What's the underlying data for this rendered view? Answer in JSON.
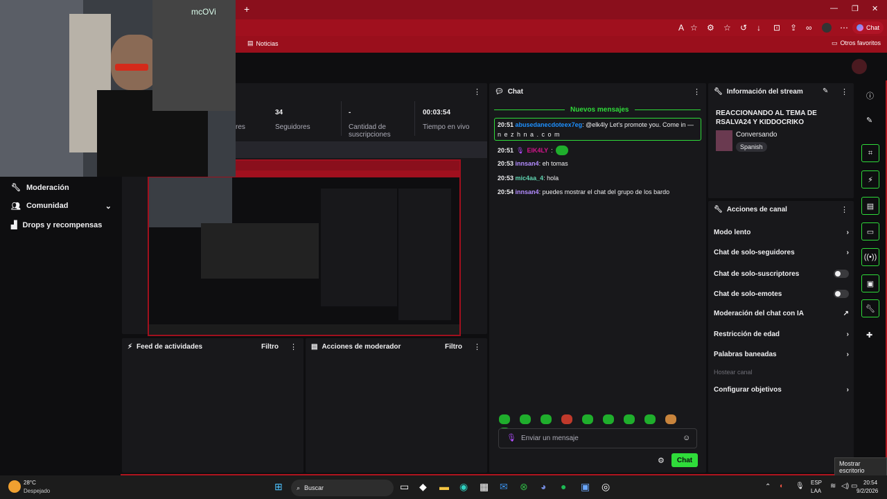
{
  "browser": {
    "bookmarks": {
      "noticias": "Noticias",
      "other": "Otros favoritos"
    },
    "chat_button": "Chat"
  },
  "webcam": {
    "watermark": "mcOVi"
  },
  "stats": {
    "seguidores_value": "34",
    "seguidores_label": "Seguidores",
    "subs_value": "-",
    "subs_label": "Cantidad de suscripciones",
    "live_value": "00:03:54",
    "live_label": "Tiempo en vivo",
    "partial_label": "res"
  },
  "sidenav": {
    "items": [
      {
        "label": "Moderación",
        "icon": "wrench-icon"
      },
      {
        "label": "Comunidad",
        "icon": "people-icon"
      },
      {
        "label": "Drops y recompensas",
        "icon": "drops-icon"
      }
    ]
  },
  "panels": {
    "activity_feed": {
      "title": "Feed de actividades",
      "filter": "Filtro"
    },
    "mod_actions": {
      "title": "Acciones de moderador",
      "filter": "Filtro"
    }
  },
  "chat": {
    "title": "Chat",
    "new_messages": "Nuevos mensajes",
    "messages": [
      {
        "time": "20:51",
        "user": "abusedanecdoteex7eg",
        "color": "#1e90ff",
        "text": ": @elk4ly Let's promote you. Come in —",
        "text2": "n e z h n a . c o m",
        "highlight": true
      },
      {
        "time": "20:51",
        "user": "ElK4LY",
        "color": "#d4148c",
        "text": ":"
      },
      {
        "time": "20:53",
        "user": "innsan4",
        "color": "#b38cff",
        "text": ": eh tomas"
      },
      {
        "time": "20:53",
        "user": "mic4aa_4",
        "color": "#5fd3b0",
        "text": ": hola"
      },
      {
        "time": "20:54",
        "user": "innsan4",
        "color": "#b38cff",
        "text": ": puedes mostrar el chat del grupo de los bardo"
      }
    ],
    "input_placeholder": "Enviar un mensaje",
    "send_label": "Chat"
  },
  "stream_info": {
    "title": "Información del stream",
    "stream_title": "REACCIONANDO AL TEMA DE RSALVA24 Y KIDDOCRIKO",
    "category": "Conversando",
    "tag": "Spanish"
  },
  "channel_actions": {
    "title": "Acciones de canal",
    "items": [
      {
        "label": "Modo lento",
        "control": "chevron"
      },
      {
        "label": "Chat de solo-seguidores",
        "control": "chevron"
      },
      {
        "label": "Chat de solo-suscriptores",
        "control": "toggle"
      },
      {
        "label": "Chat de solo-emotes",
        "control": "toggle"
      },
      {
        "label": "Moderación del chat con IA",
        "control": "external"
      },
      {
        "label": "Restricción de edad",
        "control": "chevron"
      },
      {
        "label": "Palabras baneadas",
        "control": "chevron"
      },
      {
        "label": "Hostear canal",
        "control": "none",
        "disabled": true
      },
      {
        "label": "Configurar objetivos",
        "control": "chevron"
      }
    ]
  },
  "taskbar": {
    "weather_temp": "28°C",
    "weather_desc": "Despejado",
    "search": "Buscar",
    "lang1": "ESP",
    "lang2": "LAA",
    "time": "20:54",
    "date": "9/2/2026",
    "tooltip": "Mostrar escritorio"
  },
  "colors": {
    "accent": "#2fdc3a",
    "brand_red": "#a0101e"
  }
}
